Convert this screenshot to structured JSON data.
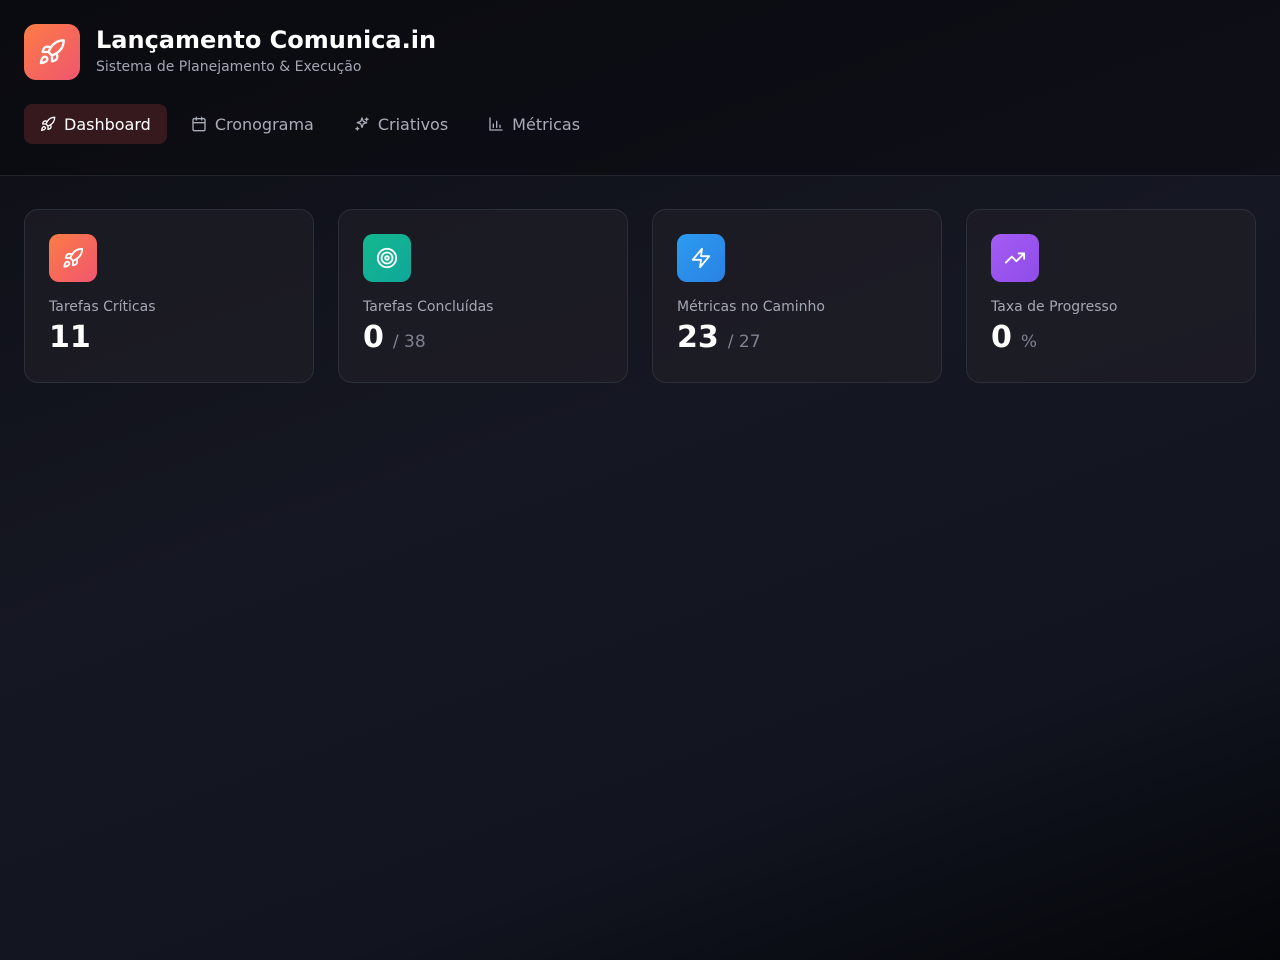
{
  "header": {
    "title": "Lançamento Comunica.in",
    "subtitle": "Sistema de Planejamento & Execução",
    "logo_icon": "rocket-icon"
  },
  "nav": {
    "items": [
      {
        "label": "Dashboard",
        "icon": "rocket-icon",
        "active": true
      },
      {
        "label": "Cronograma",
        "icon": "calendar-icon",
        "active": false
      },
      {
        "label": "Criativos",
        "icon": "sparkles-icon",
        "active": false
      },
      {
        "label": "Métricas",
        "icon": "bar-chart-icon",
        "active": false
      }
    ]
  },
  "cards": [
    {
      "label": "Tarefas Críticas",
      "value": "11",
      "suffix": "",
      "icon": "rocket-icon",
      "gradient": [
        "#fb7c45",
        "#f0566f"
      ]
    },
    {
      "label": "Tarefas Concluídas",
      "value": "0",
      "suffix": "/ 38",
      "icon": "target-icon",
      "gradient": [
        "#14b88e",
        "#0fa79a"
      ]
    },
    {
      "label": "Métricas no Caminho",
      "value": "23",
      "suffix": "/ 27",
      "icon": "zap-icon",
      "gradient": [
        "#2c9bf0",
        "#2a82e4"
      ]
    },
    {
      "label": "Taxa de Progresso",
      "value": "0",
      "suffix": "%",
      "icon": "trending-up-icon",
      "gradient": [
        "#a45cf5",
        "#8f4ce8"
      ]
    }
  ],
  "colors": {
    "accent": "#f0566f",
    "background": "#151722"
  }
}
